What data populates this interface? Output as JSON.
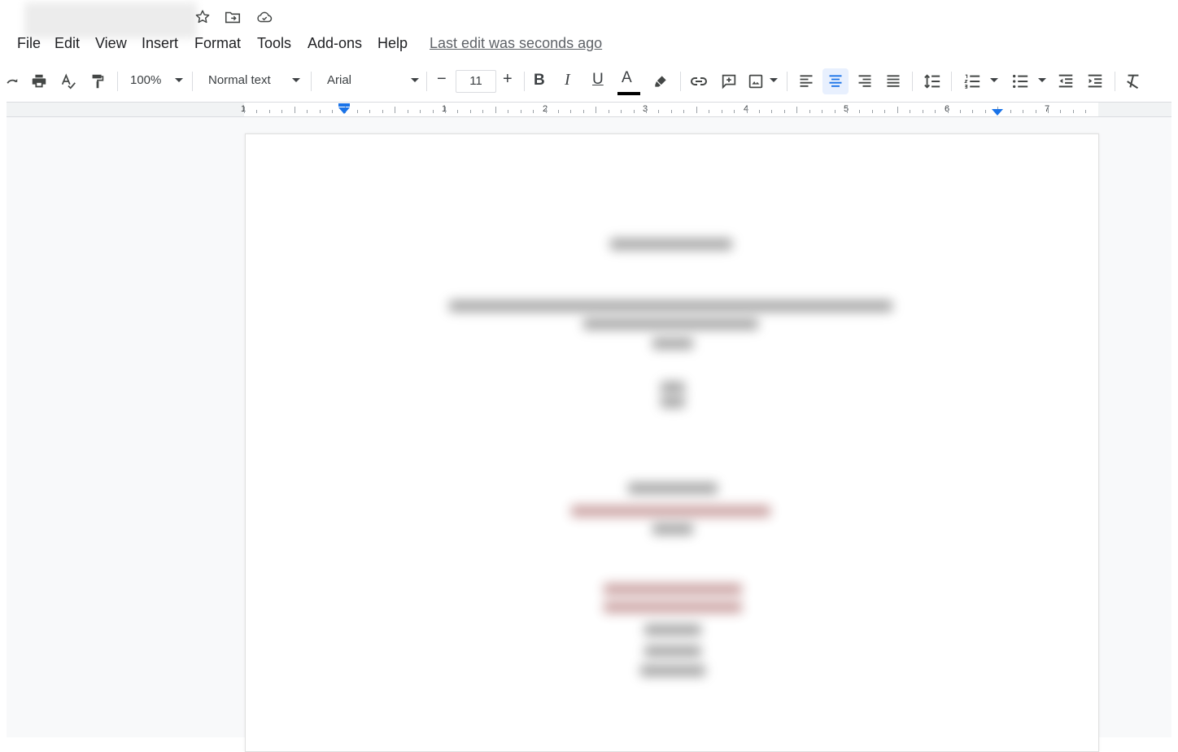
{
  "menu": {
    "items": [
      {
        "name": "menu-file",
        "label": "File"
      },
      {
        "name": "menu-edit",
        "label": "Edit"
      },
      {
        "name": "menu-view",
        "label": "View"
      },
      {
        "name": "menu-insert",
        "label": "Insert"
      },
      {
        "name": "menu-format",
        "label": "Format"
      },
      {
        "name": "menu-tools",
        "label": "Tools"
      },
      {
        "name": "menu-addons",
        "label": "Add-ons"
      },
      {
        "name": "menu-help",
        "label": "Help"
      }
    ],
    "last_edit": "Last edit was seconds ago"
  },
  "toolbar": {
    "zoom": "100%",
    "style": "Normal text",
    "font": "Arial",
    "font_size": "11",
    "minus": "−",
    "plus": "+",
    "bold": "B",
    "italic": "I",
    "underline": "U",
    "text_color": "A",
    "text_color_value": "#000000",
    "active_alignment": "center"
  },
  "ruler": {
    "numbers": [
      "1",
      "1",
      "2",
      "3",
      "4",
      "5",
      "6",
      "7"
    ],
    "indent_marker_color": "#1a73e8"
  },
  "icons": {
    "title": [
      "star-icon",
      "move-to-folder-icon",
      "cloud-saved-icon"
    ],
    "toolbar": [
      "redo-icon",
      "print-icon",
      "spellcheck-icon",
      "paint-format-icon",
      "link-icon",
      "add-comment-icon",
      "insert-image-icon",
      "align-left-icon",
      "align-center-icon",
      "align-right-icon",
      "justify-icon",
      "line-spacing-icon",
      "numbered-list-icon",
      "bulleted-list-icon",
      "decrease-indent-icon",
      "increase-indent-icon",
      "clear-formatting-icon"
    ]
  },
  "colors": {
    "accent": "#1a73e8",
    "active_bg": "#e8f0fe",
    "canvas_bg": "#f8f9fa",
    "icon": "#444746"
  }
}
